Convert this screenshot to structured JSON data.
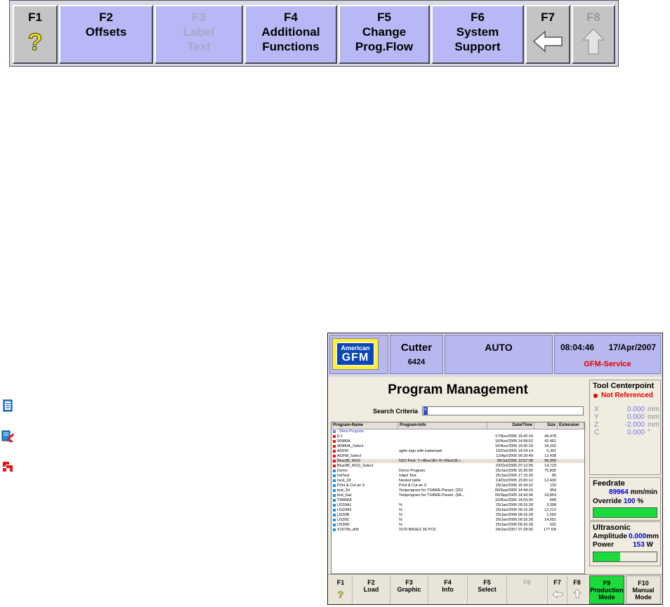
{
  "function_bar": {
    "keys": [
      {
        "key": "F1",
        "label": "",
        "icon": "help-question-icon"
      },
      {
        "key": "F2",
        "label": "Offsets"
      },
      {
        "key": "F3",
        "label1": "Label",
        "label2": "Text",
        "disabled": true
      },
      {
        "key": "F4",
        "label1": "Additional",
        "label2": "Functions"
      },
      {
        "key": "F5",
        "label1": "Change",
        "label2": "Prog.Flow"
      },
      {
        "key": "F6",
        "label1": "System",
        "label2": "Support"
      },
      {
        "key": "F7",
        "icon": "back-arrow-icon"
      },
      {
        "key": "F8",
        "icon": "up-arrow-icon",
        "disabled": true
      }
    ]
  },
  "legend_icons": [
    "program-file-icon",
    "edited-program-icon",
    "error-program-icon"
  ],
  "screen": {
    "header": {
      "logo_top": "American",
      "logo_main": "GFM",
      "machine": "Cutter",
      "machine_id": "6424",
      "mode": "AUTO",
      "time": "08:04:46",
      "date": "17/Apr/2007",
      "user": "GFM-Service"
    },
    "title": "Program Management",
    "search_label": "Search Criteria",
    "search_value": "*",
    "list": {
      "columns": [
        "Program-Name",
        "Program-Info",
        "Date/Time",
        "Size",
        "Extension"
      ],
      "rows": [
        {
          "name": "..\\New Program",
          "info": "",
          "date": "",
          "size": "",
          "type": "new"
        },
        {
          "name": "5-1",
          "info": "",
          "date": "17/Nov/2006 16:42:16",
          "size": "46,478",
          "type": "err"
        },
        {
          "name": "90980A",
          "info": "",
          "date": "16/Nov/2006 14:58:02",
          "size": "42,451",
          "type": "edit"
        },
        {
          "name": "90980A_Select",
          "info": "",
          "date": "16/Nov/2006 15:00:18",
          "size": "34,292",
          "type": "err"
        },
        {
          "name": "AGFM",
          "info": "agfm logo with trademark",
          "date": "19/Oct/2005 14:24:14",
          "size": "5,391",
          "type": "err"
        },
        {
          "name": "AGFM_Select",
          "info": "",
          "date": "12/Apr/2006 09:29:49",
          "size": "12,438",
          "type": "err"
        },
        {
          "name": "Blue3B_4010",
          "info": "NS2-Post: T-<Blue1B> R-<Blue1B.r...",
          "date": "06/Jul/2006 10:57:38",
          "size": "96,909",
          "type": "edit",
          "selected": true
        },
        {
          "name": "Blue3B_4010_Select",
          "info": "",
          "date": "03/Oct/2006 07:12:05",
          "size": "14,723",
          "type": "err"
        },
        {
          "name": "Demo",
          "info": "Demo Program",
          "date": "25/Jan/2006 16:35:50",
          "size": "75,830",
          "type": "ok"
        },
        {
          "name": "InkTest",
          "info": "Inkjet Test",
          "date": "25/Jan/2006 17:15:30",
          "size": "85",
          "type": "ok"
        },
        {
          "name": "nest_2d",
          "info": "Nested table",
          "date": "14/Oct/2005 15:00:12",
          "size": "12,430",
          "type": "ok"
        },
        {
          "name": "Print & Cut an X",
          "info": "Print & Cut an X",
          "date": "25/Jan/2006 16:34:22",
          "size": "133",
          "type": "ok"
        },
        {
          "name": "test_2d",
          "info": "Testprogram for TSAWE-Param. (2D)",
          "date": "06/Sep/2005 14:44:10",
          "size": "954",
          "type": "ok"
        },
        {
          "name": "test_5ax",
          "info": "Testprogram for TSAWE-Param. (5A...",
          "date": "06/Sep/2005 14:43:06",
          "size": "18,853",
          "type": "ok"
        },
        {
          "name": "TM990A",
          "info": "",
          "date": "16/Nov/2006 14:03:00",
          "size": "668",
          "type": "ok"
        },
        {
          "name": "US30A1",
          "info": "%",
          "date": "25/Jan/2006 09:16:28",
          "size": "3,308",
          "type": "ok"
        },
        {
          "name": "US30A2",
          "info": "%",
          "date": "25/Jan/2006 09:16:28",
          "size": "12,212",
          "type": "ok"
        },
        {
          "name": "US30B",
          "info": "%",
          "date": "25/Jan/2006 09:16:28",
          "size": "1,060",
          "type": "ok"
        },
        {
          "name": "US30C",
          "info": "%",
          "date": "25/Jan/2006 09:16:28",
          "size": "14,651",
          "type": "ok"
        },
        {
          "name": "US30D",
          "info": "%",
          "date": "25/Jan/2006 09:16:28",
          "size": "532",
          "type": "ok"
        },
        {
          "name": "X1570b_drill",
          "info": "1570 BASES 36 PCS",
          "date": "04/Jan/2007 07:28:00",
          "size": "177 KB",
          "type": "ok"
        }
      ]
    },
    "tool_centerpoint": {
      "title": "Tool Centerpoint",
      "status": "Not Referenced",
      "axes": [
        {
          "axis": "X",
          "value": "0.000",
          "unit": "mm"
        },
        {
          "axis": "Y",
          "value": "0.000",
          "unit": "mm"
        },
        {
          "axis": "Z",
          "value": "-2.000",
          "unit": "mm"
        },
        {
          "axis": "C",
          "value": "0.000",
          "unit": "°"
        }
      ]
    },
    "feedrate": {
      "title": "Feedrate",
      "value": "89964",
      "unit": "mm/min",
      "override_label": "Override",
      "override_value": "100",
      "override_unit": "%",
      "override_fraction": 1.0
    },
    "ultrasonic": {
      "title": "Ultrasonic",
      "amplitude_label": "Amplitude",
      "amplitude_value": "0.000",
      "amplitude_unit": "mm",
      "power_label": "Power",
      "power_value": "153",
      "power_unit": "W",
      "power_fraction": 0.42
    },
    "fkeys": [
      {
        "key": "F1",
        "label": "",
        "icon": "help-question-icon"
      },
      {
        "key": "F2",
        "label": "Load"
      },
      {
        "key": "F3",
        "label": "Graphic"
      },
      {
        "key": "F4",
        "label": "Info"
      },
      {
        "key": "F5",
        "label": "Select"
      },
      {
        "key": "F6",
        "label": "",
        "disabled": true
      },
      {
        "key": "F7",
        "label": "",
        "icon": "back-arrow-icon"
      },
      {
        "key": "F8",
        "label": "",
        "icon": "up-arrow-icon"
      },
      {
        "key": "F9",
        "label1": "Production",
        "label2": "Mode"
      },
      {
        "key": "F10",
        "label1": "Manual",
        "label2": "Mode"
      }
    ],
    "colors": {
      "accent": "#b8b8f0",
      "active_key": "#1adb3a",
      "status_red": "#e00000",
      "value_blue": "#0000cc"
    }
  }
}
